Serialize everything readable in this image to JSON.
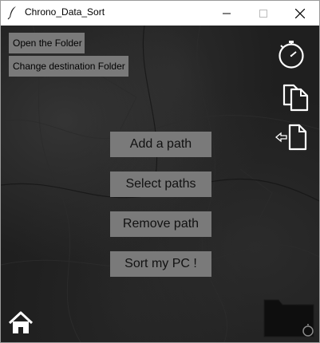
{
  "window": {
    "title": "Chrono_Data_Sort",
    "icon": "feather-icon",
    "controls": [
      "minimize-icon",
      "maximize-icon",
      "close-icon"
    ]
  },
  "toolbar": {
    "open_folder_label": "Open the Folder",
    "change_destination_label": "Change destination Folder"
  },
  "actions": {
    "add_path_label": "Add a path",
    "select_paths_label": "Select paths",
    "remove_path_label": "Remove path",
    "sort_label": "Sort my PC !"
  },
  "side_icons": [
    "stopwatch-icon",
    "copy-files-icon",
    "move-file-icon"
  ],
  "bottom_icons": [
    "home-icon",
    "folder-timer-icon"
  ],
  "colors": {
    "background": "#1f1f1f",
    "button": "#7a7a7a",
    "icon": "#ffffff"
  }
}
